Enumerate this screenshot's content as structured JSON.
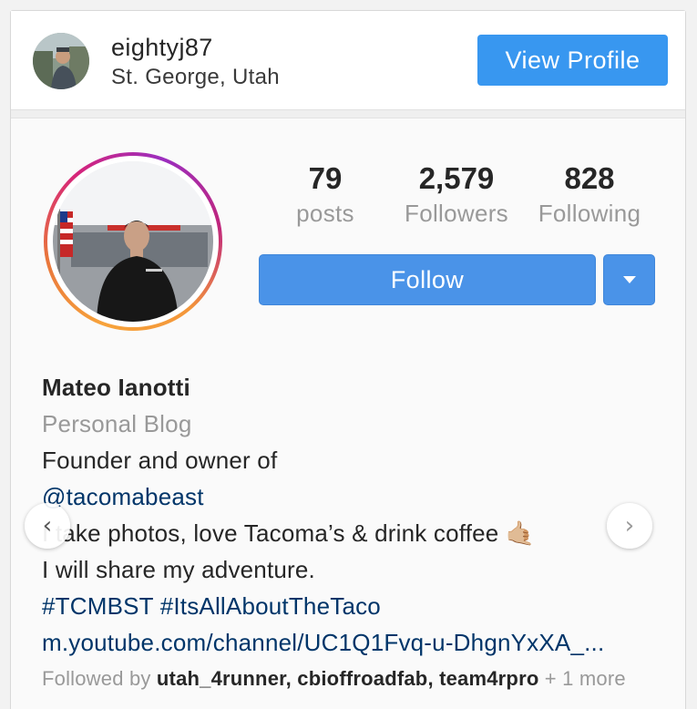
{
  "header": {
    "username": "eightyj87",
    "location": "St. George, Utah",
    "view_profile_label": "View Profile",
    "avatar_icon": "user-avatar"
  },
  "profile": {
    "avatar_icon": "profile-photo",
    "stats": {
      "posts": {
        "value": "79",
        "label": "posts"
      },
      "followers": {
        "value": "2,579",
        "label": "Followers"
      },
      "following": {
        "value": "828",
        "label": "Following"
      }
    },
    "follow_label": "Follow",
    "dropdown_icon": "caret-down-icon"
  },
  "bio": {
    "name": "Mateo Ianotti",
    "category": "Personal Blog",
    "line1": "Founder and owner of",
    "mention": "@tacomabeast",
    "line3": "I take photos, love Tacoma’s & drink coffee 🤙🏼",
    "line4": "I will share my adventure.",
    "hashtags": "#TCMBST  #ItsAllAboutTheTaco",
    "website": "m.youtube.com/channel/UC1Q1Fvq-u-DhgnYxXA_...",
    "followed_by_prefix": "Followed by",
    "followed_by_users": "utah_4runner, cbioffroadfab, team4rpro",
    "followed_by_more": "+ 1 more"
  },
  "carousel": {
    "prev_icon": "chevron-left-icon",
    "next_icon": "chevron-right-icon",
    "prev_glyph": "‹",
    "next_glyph": "›"
  },
  "colors": {
    "accent": "#3897f0",
    "follow": "#4a93e8",
    "link": "#003569",
    "muted": "#999999"
  }
}
